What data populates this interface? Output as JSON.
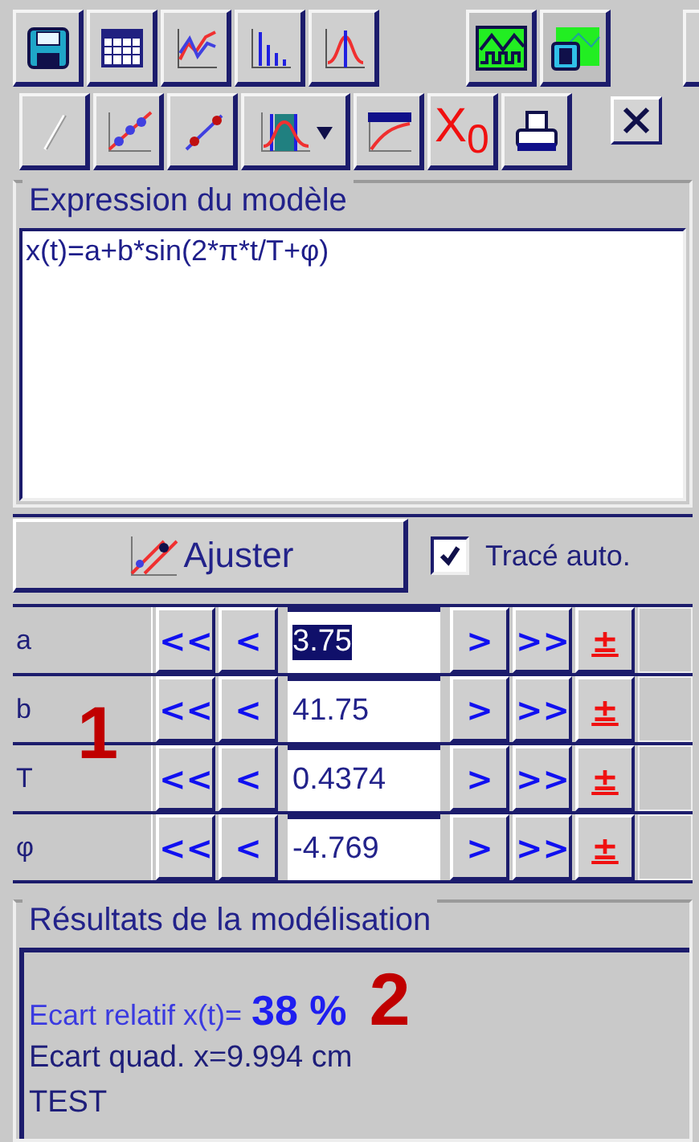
{
  "toolbar_2": {
    "clear_label": "X$_{0}$"
  },
  "expression": {
    "title": "Expression du modèle",
    "value": "x(t)=a+b*sin(2*π*t/T+φ)"
  },
  "fit": {
    "button": "Ajuster",
    "auto_plot": {
      "label": "Tracé auto.",
      "checked": true
    }
  },
  "params": {
    "marker": "1",
    "rows": [
      {
        "name": "a",
        "value": "3.75",
        "selected": true,
        "buttons": [
          "<<",
          "<",
          ">",
          ">>",
          "±"
        ]
      },
      {
        "name": "b",
        "value": "41.75",
        "selected": false,
        "buttons": [
          "<<",
          "<",
          ">",
          ">>",
          "±"
        ]
      },
      {
        "name": "T",
        "value": "0.4374",
        "selected": false,
        "buttons": [
          "<<",
          "<",
          ">",
          ">>",
          "±"
        ]
      },
      {
        "name": "φ",
        "value": "-4.769",
        "selected": false,
        "buttons": [
          "<<",
          "<",
          ">",
          ">>",
          "±"
        ]
      }
    ]
  },
  "results": {
    "title": "Résultats de la modélisation",
    "marker": "2",
    "relative": {
      "label": "Ecart relatif x(t)=",
      "value": "38 %"
    },
    "lines": [
      "Ecart quad. x=9.994 cm",
      "TEST"
    ]
  }
}
